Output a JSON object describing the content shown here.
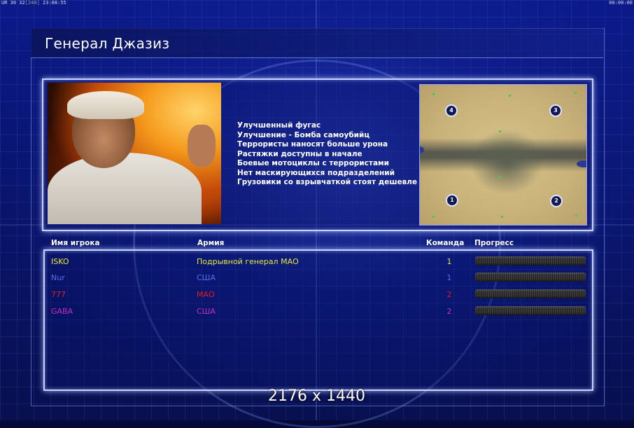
{
  "hud": {
    "left_top": "UR 30",
    "left_mid": "32",
    "left_bracket": "[240]",
    "left_time": "23:08:55",
    "right_time": "00:00:00"
  },
  "header": {
    "title": "Генерал Джазиз"
  },
  "general": {
    "portrait_alt": "general-portrait",
    "bonuses": [
      "Улучшенный фугас",
      "Улучшение - Бомба самоубийц",
      "Террористы наносят больше урона",
      "Растяжки доступны в начале",
      "Боевые мотоциклы с террористами",
      "Нет маскирующихся подразделений",
      "Грузовики со взрывчаткой стоят дешевле"
    ]
  },
  "map": {
    "spawns": [
      "4",
      "3",
      "1",
      "2"
    ]
  },
  "table": {
    "headers": {
      "name": "Имя игрока",
      "army": "Армия",
      "team": "Команда",
      "progress": "Прогресс"
    },
    "rows": [
      {
        "name": "ISKO",
        "army": "Подрывной генерал МАО",
        "team": "1",
        "color": "#e8e83a",
        "progress": 1.0
      },
      {
        "name": "Nur",
        "army": "США",
        "team": "1",
        "color": "#5a70e8",
        "progress": 1.0
      },
      {
        "name": "777",
        "army": "МАО",
        "team": "2",
        "color": "#e81c1c",
        "progress": 1.0
      },
      {
        "name": "GABA",
        "army": "США",
        "team": "2",
        "color": "#c42cc4",
        "progress": 1.0
      }
    ]
  },
  "overlay": {
    "resolution": "2176 x 1440"
  }
}
